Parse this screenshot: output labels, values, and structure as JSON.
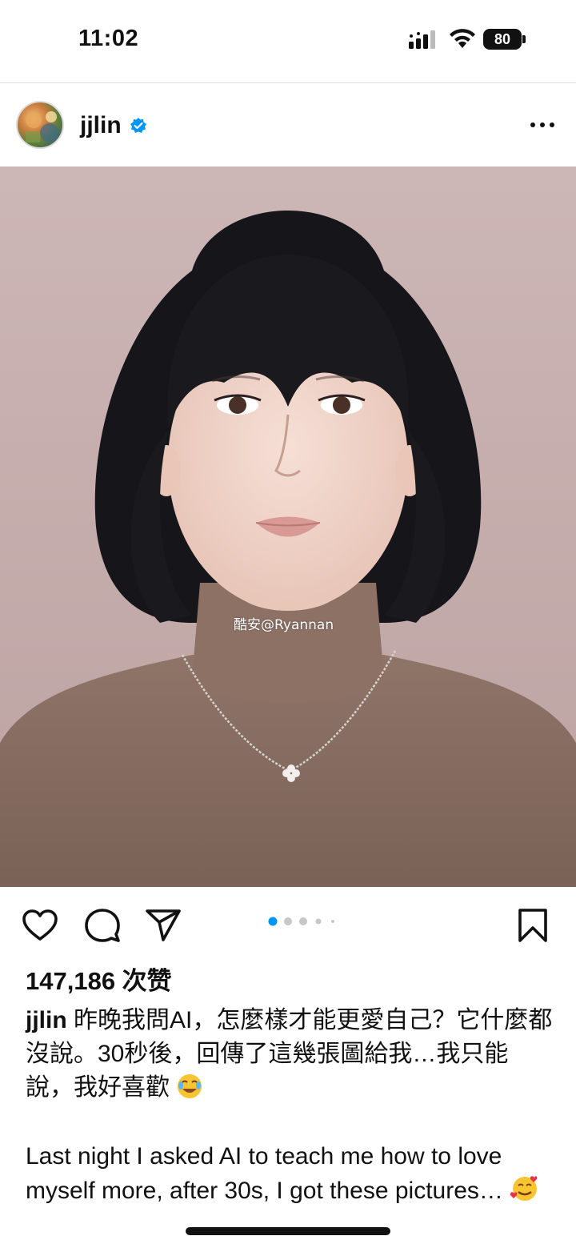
{
  "status_bar": {
    "time": "11:02",
    "battery": "80",
    "icons": [
      "signal-icon",
      "wifi-icon",
      "battery-icon"
    ]
  },
  "post": {
    "username": "jjlin",
    "verified": true,
    "more_icon": "more-horizontal-icon",
    "image": {
      "watermark": "酷安@Ryannan",
      "carousel_index": 1,
      "carousel_count": 5
    },
    "actions": {
      "like_icon": "heart-icon",
      "comment_icon": "comment-icon",
      "share_icon": "send-icon",
      "save_icon": "bookmark-icon"
    },
    "likes": "147,186 次赞",
    "caption": {
      "username": "jjlin",
      "text_zh": " 昨晚我問AI，怎麼樣才能更愛自己？它什麼都沒說。30秒後，回傳了這幾張圖給我…我只能說，我好喜歡",
      "text_en": "Last night I asked AI to teach me how to love myself more, after 30s, I got these pictures…"
    }
  },
  "colors": {
    "accent_blue": "#0095f6",
    "text": "#111111",
    "photo_background": "#c9b2b2"
  }
}
